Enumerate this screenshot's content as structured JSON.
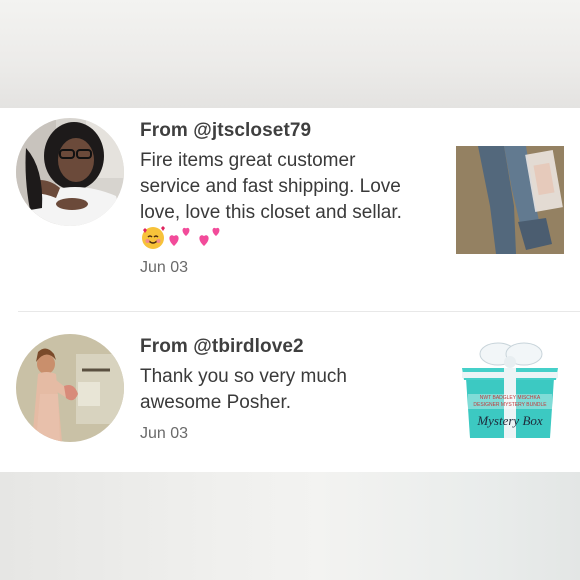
{
  "reviews": [
    {
      "user": "From @jtscloset79",
      "text_lines": [
        "Fire items great customer",
        "service and fast shipping. Love",
        "love, love this closet and sellar."
      ],
      "emoji_names": [
        "smiling-face-with-hearts",
        "two-hearts",
        "two-hearts"
      ],
      "date": "Jun 03",
      "thumbnail": "jeans-and-shoes-photo"
    },
    {
      "user": "From @tbirdlove2",
      "text_lines": [
        "Thank you so very much",
        "awesome Posher."
      ],
      "date": "Jun 03",
      "thumbnail": {
        "label_line1": "NWT BADGLEY MISCHKA",
        "label_line2": "DESIGNER MYSTERY BUNDLE",
        "script_text": "Mystery Box"
      }
    }
  ],
  "colors": {
    "text": "#3a3a3a",
    "date": "#6a6a6a",
    "tiffany": "#3cc9c2"
  }
}
